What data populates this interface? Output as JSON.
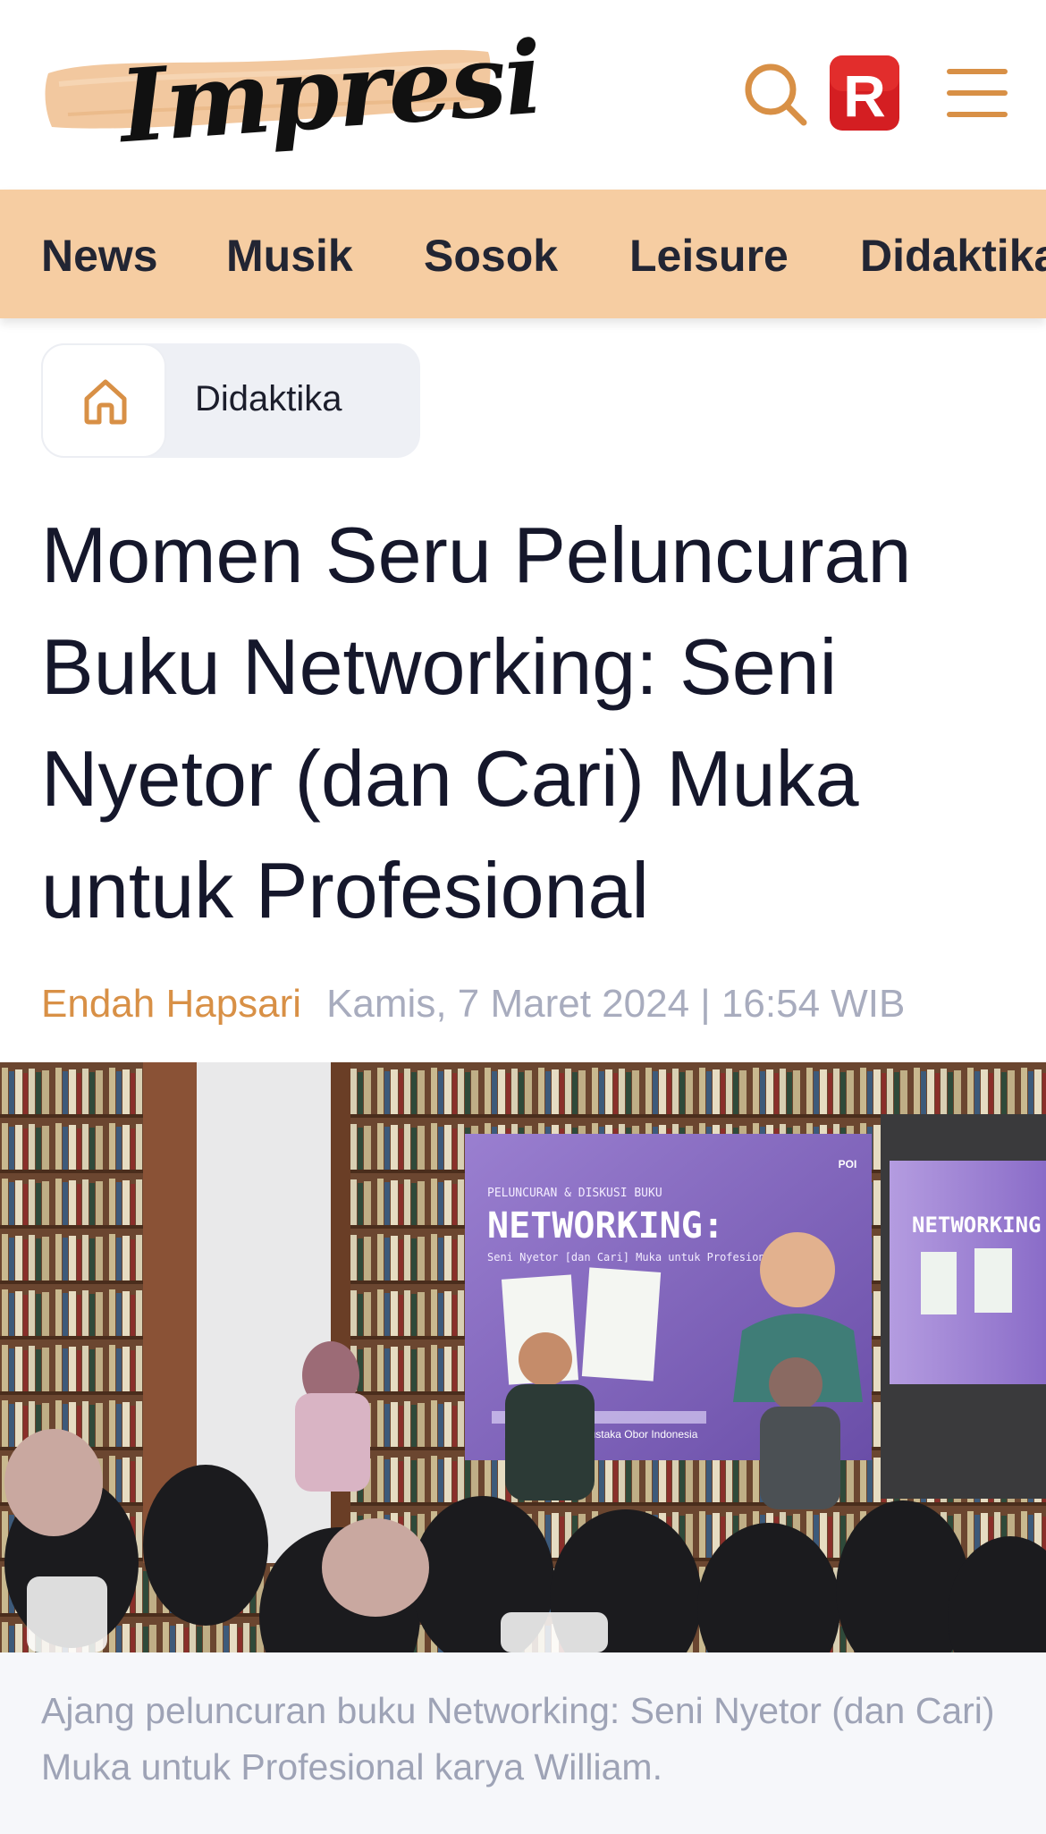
{
  "header": {
    "logo_text": "Impresi",
    "search_icon": "search-icon",
    "r_badge_letter": "R",
    "menu_icon": "hamburger-menu-icon"
  },
  "nav": {
    "items": [
      {
        "label": "News"
      },
      {
        "label": "Musik"
      },
      {
        "label": "Sosok"
      },
      {
        "label": "Leisure"
      },
      {
        "label": "Didaktika"
      }
    ]
  },
  "breadcrumb": {
    "home_icon": "home-icon",
    "current": "Didaktika"
  },
  "article": {
    "title": "Momen Seru Peluncuran Buku Networking: Seni Nyetor (dan Cari) Muka untuk Profesional",
    "author": "Endah Hapsari",
    "date": "Kamis, 7 Maret 2024 | 16:54 WIB",
    "image": {
      "banner_kicker": "PELUNCURAN & DISKUSI BUKU",
      "banner_title": "NETWORKING:",
      "banner_subtitle": "Seni Nyetor [dan Cari] Muka untuk Profesional",
      "screen_title": "NETWORKING",
      "banner_venue": "Kantor Yayasan Pustaka Obor Indonesia",
      "banner_logo": "POI"
    },
    "caption": "Ajang peluncuran buku Networking: Seni Nyetor (dan Cari) Muka untuk Profesional karya William."
  },
  "colors": {
    "accent": "#d89046",
    "nav_bg": "#f6cda2",
    "badge_red": "#e0262a",
    "muted_text": "#a8acbe"
  }
}
